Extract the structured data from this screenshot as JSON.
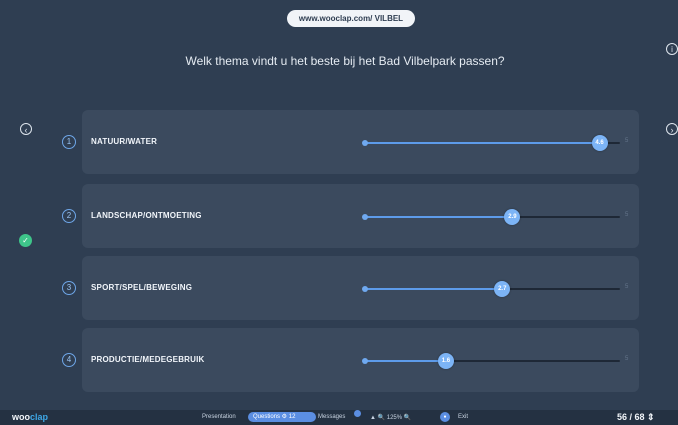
{
  "header": {
    "url": "www.wooclap.com/ VILBEL"
  },
  "question": "Welk thema vindt u het beste bij het Bad Vilbelpark passen?",
  "max_scale": "5",
  "rows": [
    {
      "number": "1",
      "label": "NATUUR/WATER",
      "value": "4.6",
      "fraction": 0.92
    },
    {
      "number": "2",
      "label": "LANDSCHAP/ONTMOETING",
      "value": "2.9",
      "fraction": 0.58
    },
    {
      "number": "3",
      "label": "SPORT/SPEL/BEWEGING",
      "value": "2.7",
      "fraction": 0.54
    },
    {
      "number": "4",
      "label": "PRODUCTIE/MEDEGEBRUIK",
      "value": "1.6",
      "fraction": 0.32
    }
  ],
  "footer": {
    "brand_main": "woo",
    "brand_accent": "clap",
    "presentation": "Presentation",
    "questions": "Questions ⚙ 12",
    "messages": "Messages",
    "zoom": "▲  🔍  125%  🔍",
    "exit": "Exit",
    "page_counter": "56 / 68 ⇕"
  },
  "colors": {
    "background": "#2f3e52",
    "row": "#3b4a5e",
    "accent": "#5d9bea",
    "knob": "#7cb4f6"
  }
}
